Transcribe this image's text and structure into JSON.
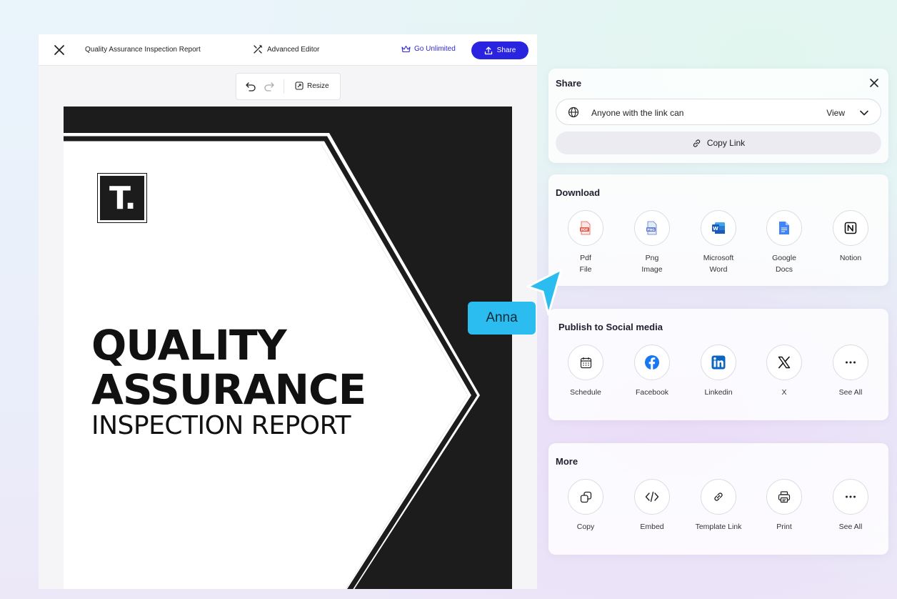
{
  "topbar": {
    "title": "Quality Assurance Inspection Report",
    "advanced_editor": "Advanced Editor",
    "go_unlimited": "Go Unlimited",
    "share": "Share"
  },
  "toolbar": {
    "resize": "Resize"
  },
  "cover": {
    "logo_letter": "T.",
    "title_line1": "QUALITY",
    "title_line2": "ASSURANCE",
    "subtitle": "INSPECTION REPORT"
  },
  "share_panel": {
    "title": "Share",
    "access_text": "Anyone with the link can",
    "permission": "View",
    "copy_link": "Copy Link"
  },
  "download": {
    "title": "Download",
    "items": [
      {
        "line1": "Pdf",
        "line2": "File",
        "icon": "pdf-file-icon"
      },
      {
        "line1": "Png",
        "line2": "Image",
        "icon": "png-image-icon"
      },
      {
        "line1": "Microsoft",
        "line2": "Word",
        "icon": "microsoft-word-icon"
      },
      {
        "line1": "Google",
        "line2": "Docs",
        "icon": "google-docs-icon"
      },
      {
        "line1": "Notion",
        "line2": "",
        "icon": "notion-icon"
      }
    ]
  },
  "social": {
    "title": "Publish to Social media",
    "items": [
      {
        "label": "Schedule",
        "icon": "calendar-icon"
      },
      {
        "label": "Facebook",
        "icon": "facebook-icon"
      },
      {
        "label": "Linkedin",
        "icon": "linkedin-icon"
      },
      {
        "label": "X",
        "icon": "x-icon"
      },
      {
        "label": "See All",
        "icon": "more-dots-icon"
      }
    ]
  },
  "more": {
    "title": "More",
    "items": [
      {
        "label": "Copy",
        "icon": "copy-icon"
      },
      {
        "label": "Embed",
        "icon": "code-icon"
      },
      {
        "label": "Template Link",
        "icon": "link-icon"
      },
      {
        "label": "Print",
        "icon": "printer-icon"
      },
      {
        "label": "See All",
        "icon": "more-dots-icon"
      }
    ]
  },
  "collaborator": {
    "name": "Anna"
  },
  "colors": {
    "primary": "#2a24e0",
    "cursor": "#2bbdf0",
    "cover_dark": "#1c1c1c"
  }
}
